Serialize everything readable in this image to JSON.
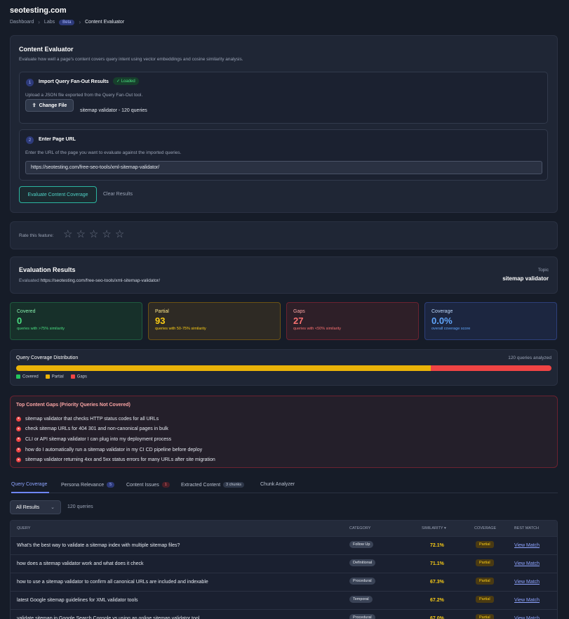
{
  "site_title": "seotesting.com",
  "breadcrumb": {
    "items": [
      "Dashboard",
      "Labs"
    ],
    "beta": "Beta",
    "current": "Content Evaluator"
  },
  "evaluator": {
    "title": "Content Evaluator",
    "description": "Evaluate how well a page's content covers query intent using vector embeddings and cosine similarity analysis.",
    "step1": {
      "num": "1",
      "title": "Import Query Fan-Out Results",
      "status": "Loaded",
      "desc": "Upload a JSON file exported from the Query Fan-Out tool.",
      "button": "Change File",
      "file": "sitemap validator - 120 queries"
    },
    "step2": {
      "num": "2",
      "title": "Enter Page URL",
      "desc": "Enter the URL of the page you want to evaluate against the imported queries.",
      "url": "https://seotesting.com/free-seo-tools/xml-sitemap-validator/"
    },
    "evaluate_button": "Evaluate Content Coverage",
    "clear_button": "Clear Results"
  },
  "rating": {
    "label": "Rate this feature:",
    "stars": [
      "☆",
      "☆",
      "☆",
      "☆",
      "☆"
    ]
  },
  "results": {
    "title": "Evaluation Results",
    "evaluated_prefix": "Evaluated",
    "evaluated_url": "https://seotesting.com/free-seo-tools/xml-sitemap-validator/",
    "topic_label": "Topic",
    "topic": "sitemap validator"
  },
  "stats": {
    "covered": {
      "label": "Covered",
      "value": "0",
      "sub": "queries with >75% similarity"
    },
    "partial": {
      "label": "Partial",
      "value": "93",
      "sub": "queries with 50-75% similarity"
    },
    "gaps": {
      "label": "Gaps",
      "value": "27",
      "sub": "queries with <50% similarity"
    },
    "coverage": {
      "label": "Coverage",
      "value": "0.0%",
      "sub": "overall coverage score"
    }
  },
  "distribution": {
    "title": "Query Coverage Distribution",
    "analyzed": "120 queries analyzed",
    "covered": 0,
    "partial": 93,
    "gaps": 27,
    "colors": {
      "covered": "#22c55e",
      "partial": "#eab308",
      "gaps": "#ef4444"
    },
    "legend": [
      "Covered",
      "Partial",
      "Gaps"
    ]
  },
  "top_gaps": {
    "title": "Top Content Gaps (Priority Queries Not Covered)",
    "items": [
      "sitemap validator that checks HTTP status codes for all URLs",
      "check sitemap URLs for 404 301 and non-canonical pages in bulk",
      "CLI or API sitemap validator I can plug into my deployment process",
      "how do I automatically run a sitemap validator in my CI CD pipeline before deploy",
      "sitemap validator returning 4xx and 5xx status errors for many URLs after site migration"
    ]
  },
  "tabs": [
    {
      "label": "Query Coverage",
      "badge": ""
    },
    {
      "label": "Persona Relevance",
      "badge": "5"
    },
    {
      "label": "Content Issues",
      "badge": "1"
    },
    {
      "label": "Extracted Content",
      "badge": "3 chunks"
    },
    {
      "label": "Chunk Analyzer",
      "badge": ""
    }
  ],
  "filter": {
    "selected": "All Results",
    "count": "120 queries"
  },
  "table": {
    "headers": [
      "QUERY",
      "CATEGORY",
      "SIMILARITY",
      "COVERAGE",
      "BEST MATCH"
    ],
    "rows": [
      {
        "query": "What's the best way to validate a sitemap index with multiple sitemap files?",
        "category": "Follow Up",
        "similarity": "72.1%",
        "coverage": "Partial",
        "match": "View Match"
      },
      {
        "query": "how does a sitemap validator work and what does it check",
        "category": "Definitional",
        "similarity": "71.1%",
        "coverage": "Partial",
        "match": "View Match"
      },
      {
        "query": "how to use a sitemap validator to confirm all canonical URLs are included and indexable",
        "category": "Procedural",
        "similarity": "67.3%",
        "coverage": "Partial",
        "match": "View Match"
      },
      {
        "query": "latest Google sitemap guidelines for XML validator tools",
        "category": "Temporal",
        "similarity": "67.2%",
        "coverage": "Partial",
        "match": "View Match"
      },
      {
        "query": "validate sitemap in Google Search Console vs using an online sitemap validator tool",
        "category": "Procedural",
        "similarity": "67.0%",
        "coverage": "Partial",
        "match": "View Match"
      }
    ]
  }
}
